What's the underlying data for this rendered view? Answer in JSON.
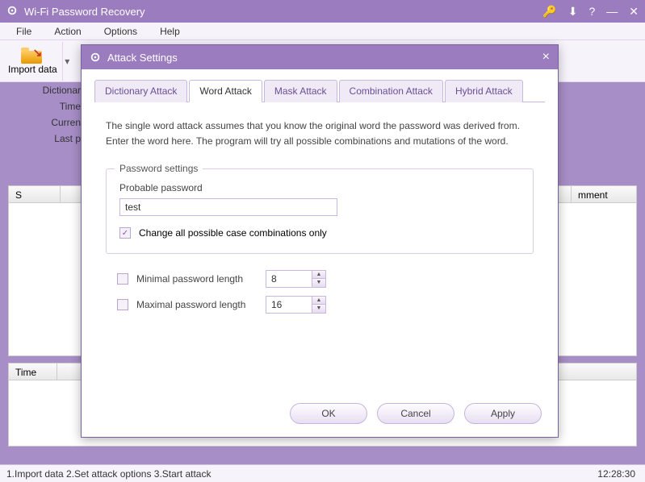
{
  "window": {
    "title": "Wi-Fi Password Recovery"
  },
  "menubar": {
    "file": "File",
    "action": "Action",
    "options": "Options",
    "help": "Help"
  },
  "toolbar": {
    "import_data": "Import data"
  },
  "info_labels": {
    "dictionary": "Dictionar",
    "time": "Time",
    "current": "Curren",
    "last": "Last p"
  },
  "columns": {
    "ssid": "S",
    "comment": "mment"
  },
  "time_col": "Time",
  "dialog": {
    "title": "Attack Settings",
    "tabs": {
      "dictionary": "Dictionary Attack",
      "word": "Word Attack",
      "mask": "Mask Attack",
      "combination": "Combination Attack",
      "hybrid": "Hybrid Attack"
    },
    "description": "The single word attack assumes that you know the original word the password was derived from. Enter the word here. The program will try all possible combinations and mutations of the word.",
    "fieldset_legend": "Password settings",
    "probable_label": "Probable password",
    "probable_value": "test",
    "case_combinations_label": "Change all possible case combinations only",
    "min_length_label": "Minimal password length",
    "min_length_value": "8",
    "max_length_label": "Maximal password length",
    "max_length_value": "16",
    "buttons": {
      "ok": "OK",
      "cancel": "Cancel",
      "apply": "Apply"
    }
  },
  "statusbar": {
    "text": "1.Import data  2.Set attack options  3.Start attack",
    "time": "12:28:30"
  }
}
